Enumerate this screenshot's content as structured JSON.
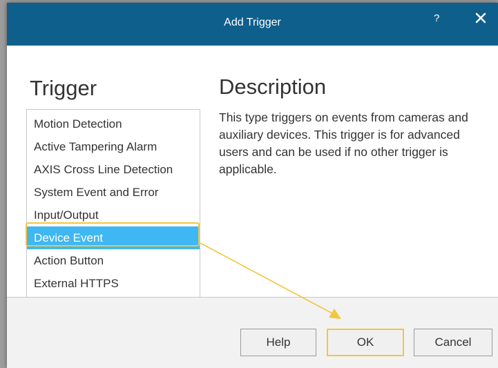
{
  "dialog": {
    "title": "Add Trigger",
    "help_glyph": "?",
    "close_icon": "close-icon"
  },
  "trigger": {
    "heading": "Trigger",
    "items": [
      {
        "label": "Motion Detection"
      },
      {
        "label": "Active Tampering Alarm"
      },
      {
        "label": "AXIS Cross Line Detection"
      },
      {
        "label": "System Event and Error"
      },
      {
        "label": "Input/Output"
      },
      {
        "label": "Device Event",
        "selected": true
      },
      {
        "label": "Action Button"
      },
      {
        "label": "External HTTPS"
      }
    ]
  },
  "description": {
    "heading": "Description",
    "text": "This type triggers on events from cameras and auxiliary devices. This trigger is for advanced users and can be used if no other trigger is applicable."
  },
  "buttons": {
    "help": "Help",
    "ok": "OK",
    "cancel": "Cancel"
  },
  "colors": {
    "titlebar": "#0f5f8c",
    "selection": "#3fb7f2",
    "highlight": "#f2c641"
  }
}
